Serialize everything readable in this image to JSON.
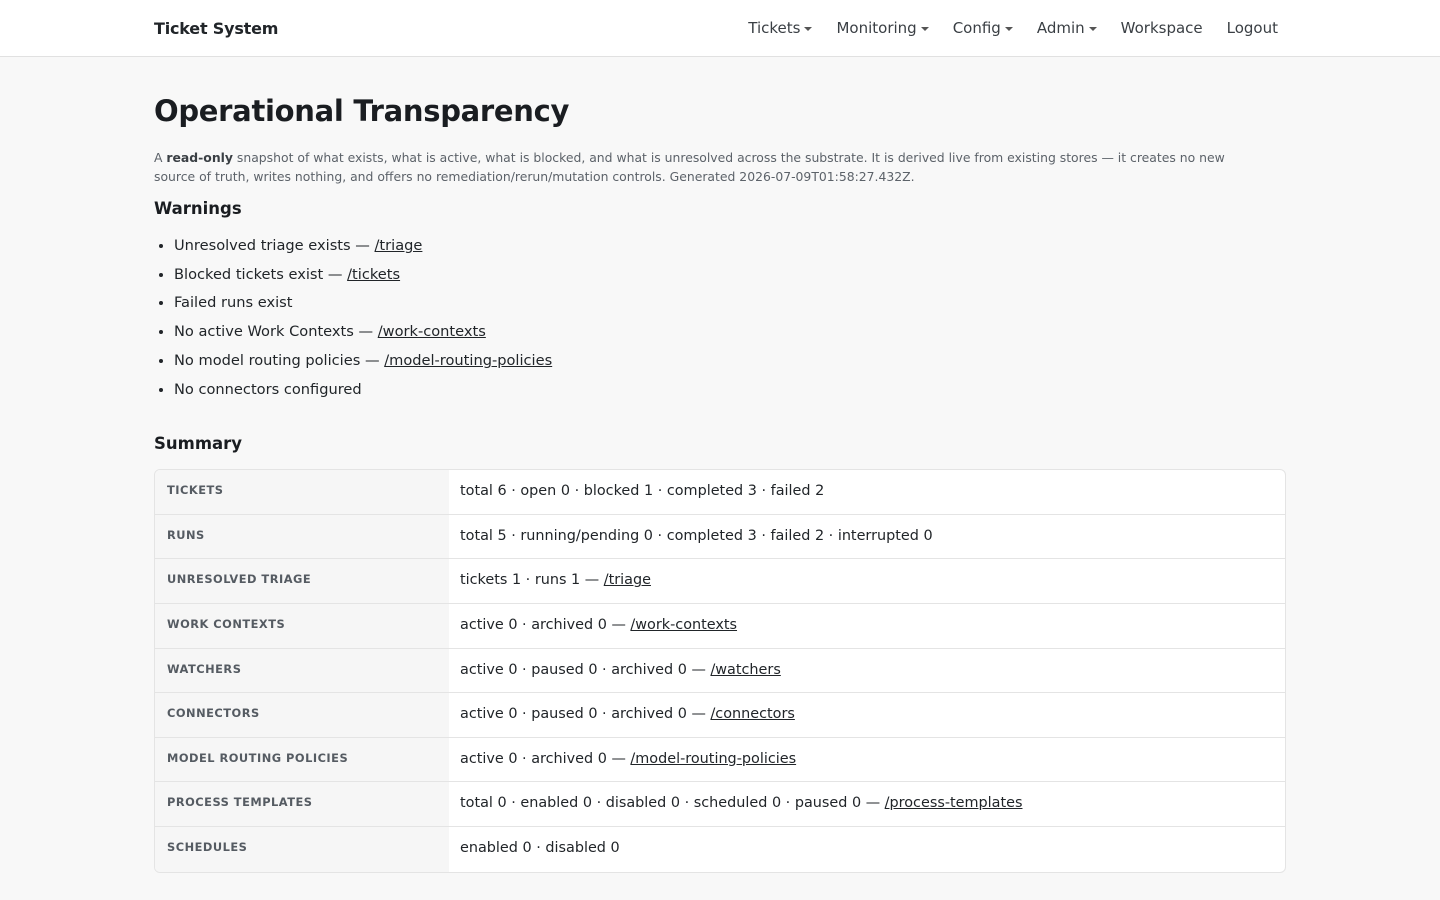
{
  "navbar": {
    "brand": "Ticket System",
    "items": [
      {
        "label": "Tickets",
        "dropdown": true
      },
      {
        "label": "Monitoring",
        "dropdown": true
      },
      {
        "label": "Config",
        "dropdown": true
      },
      {
        "label": "Admin",
        "dropdown": true
      },
      {
        "label": "Workspace",
        "dropdown": false
      },
      {
        "label": "Logout",
        "dropdown": false
      }
    ]
  },
  "page": {
    "title": "Operational Transparency",
    "intro_prefix": "A ",
    "intro_bold": "read-only",
    "intro_rest": " snapshot of what exists, what is active, what is blocked, and what is unresolved across the substrate. It is derived live from existing stores — it creates no new source of truth, writes nothing, and offers no remediation/rerun/mutation controls. Generated 2026-07-09T01:58:27.432Z."
  },
  "warnings": {
    "title": "Warnings",
    "items": [
      {
        "text": "Unresolved triage exists — ",
        "link": "/triage"
      },
      {
        "text": "Blocked tickets exist — ",
        "link": "/tickets"
      },
      {
        "text": "Failed runs exist",
        "link": ""
      },
      {
        "text": "No active Work Contexts — ",
        "link": "/work-contexts"
      },
      {
        "text": "No model routing policies — ",
        "link": "/model-routing-policies"
      },
      {
        "text": "No connectors configured",
        "link": ""
      }
    ]
  },
  "summary": {
    "title": "Summary",
    "rows": [
      {
        "label": "Tickets",
        "value": "total 6 · open 0 · blocked 1 · completed 3 · failed 2",
        "link": ""
      },
      {
        "label": "Runs",
        "value": "total 5 · running/pending 0 · completed 3 · failed 2 · interrupted 0",
        "link": ""
      },
      {
        "label": "Unresolved Triage",
        "value": "tickets 1 · runs 1 — ",
        "link": "/triage"
      },
      {
        "label": "Work Contexts",
        "value": "active 0 · archived 0 — ",
        "link": "/work-contexts"
      },
      {
        "label": "Watchers",
        "value": "active 0 · paused 0 · archived 0 — ",
        "link": "/watchers"
      },
      {
        "label": "Connectors",
        "value": "active 0 · paused 0 · archived 0 — ",
        "link": "/connectors"
      },
      {
        "label": "Model Routing Policies",
        "value": "active 0 · archived 0 — ",
        "link": "/model-routing-policies"
      },
      {
        "label": "Process Templates",
        "value": "total 0 · enabled 0 · disabled 0 · scheduled 0 · paused 0 — ",
        "link": "/process-templates"
      },
      {
        "label": "Schedules",
        "value": "enabled 0 · disabled 0",
        "link": ""
      }
    ]
  }
}
